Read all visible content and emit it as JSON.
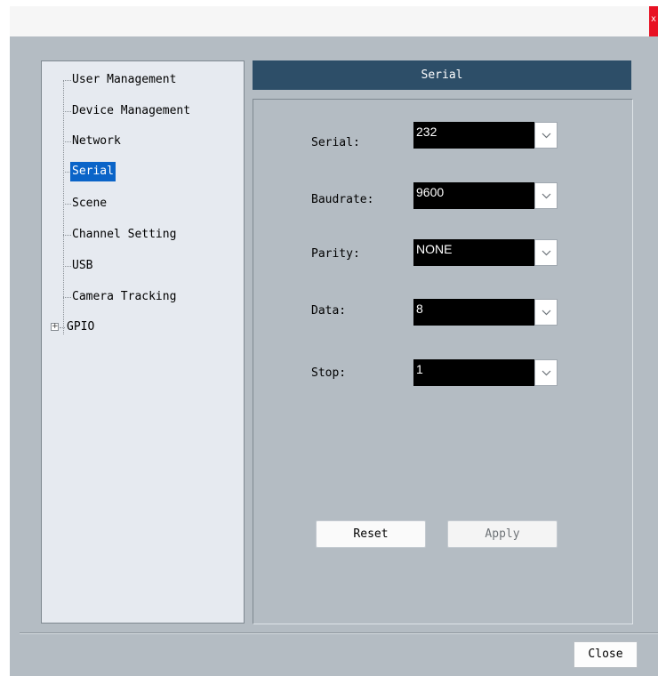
{
  "window": {
    "close_glyph": "x"
  },
  "tree": {
    "items": [
      {
        "label": "User Management"
      },
      {
        "label": "Device Management"
      },
      {
        "label": "Network"
      },
      {
        "label": "Serial",
        "selected": true
      },
      {
        "label": "Scene"
      },
      {
        "label": "Channel Setting"
      },
      {
        "label": "USB"
      },
      {
        "label": "Camera Tracking"
      },
      {
        "label": "GPIO",
        "expandable": true
      }
    ],
    "expander_glyph": "+"
  },
  "panel": {
    "title": "Serial",
    "fields": [
      {
        "label": "Serial:",
        "value": "232"
      },
      {
        "label": "Baudrate:",
        "value": "9600"
      },
      {
        "label": "Parity:",
        "value": "NONE"
      },
      {
        "label": "Data:",
        "value": "8"
      },
      {
        "label": "Stop:",
        "value": "1"
      }
    ],
    "reset_label": "Reset",
    "apply_label": "Apply"
  },
  "footer": {
    "close_label": "Close"
  },
  "colors": {
    "header_bg": "#2d4e68",
    "selection": "#0a64c8",
    "dialog_bg": "#b4bcc3"
  }
}
